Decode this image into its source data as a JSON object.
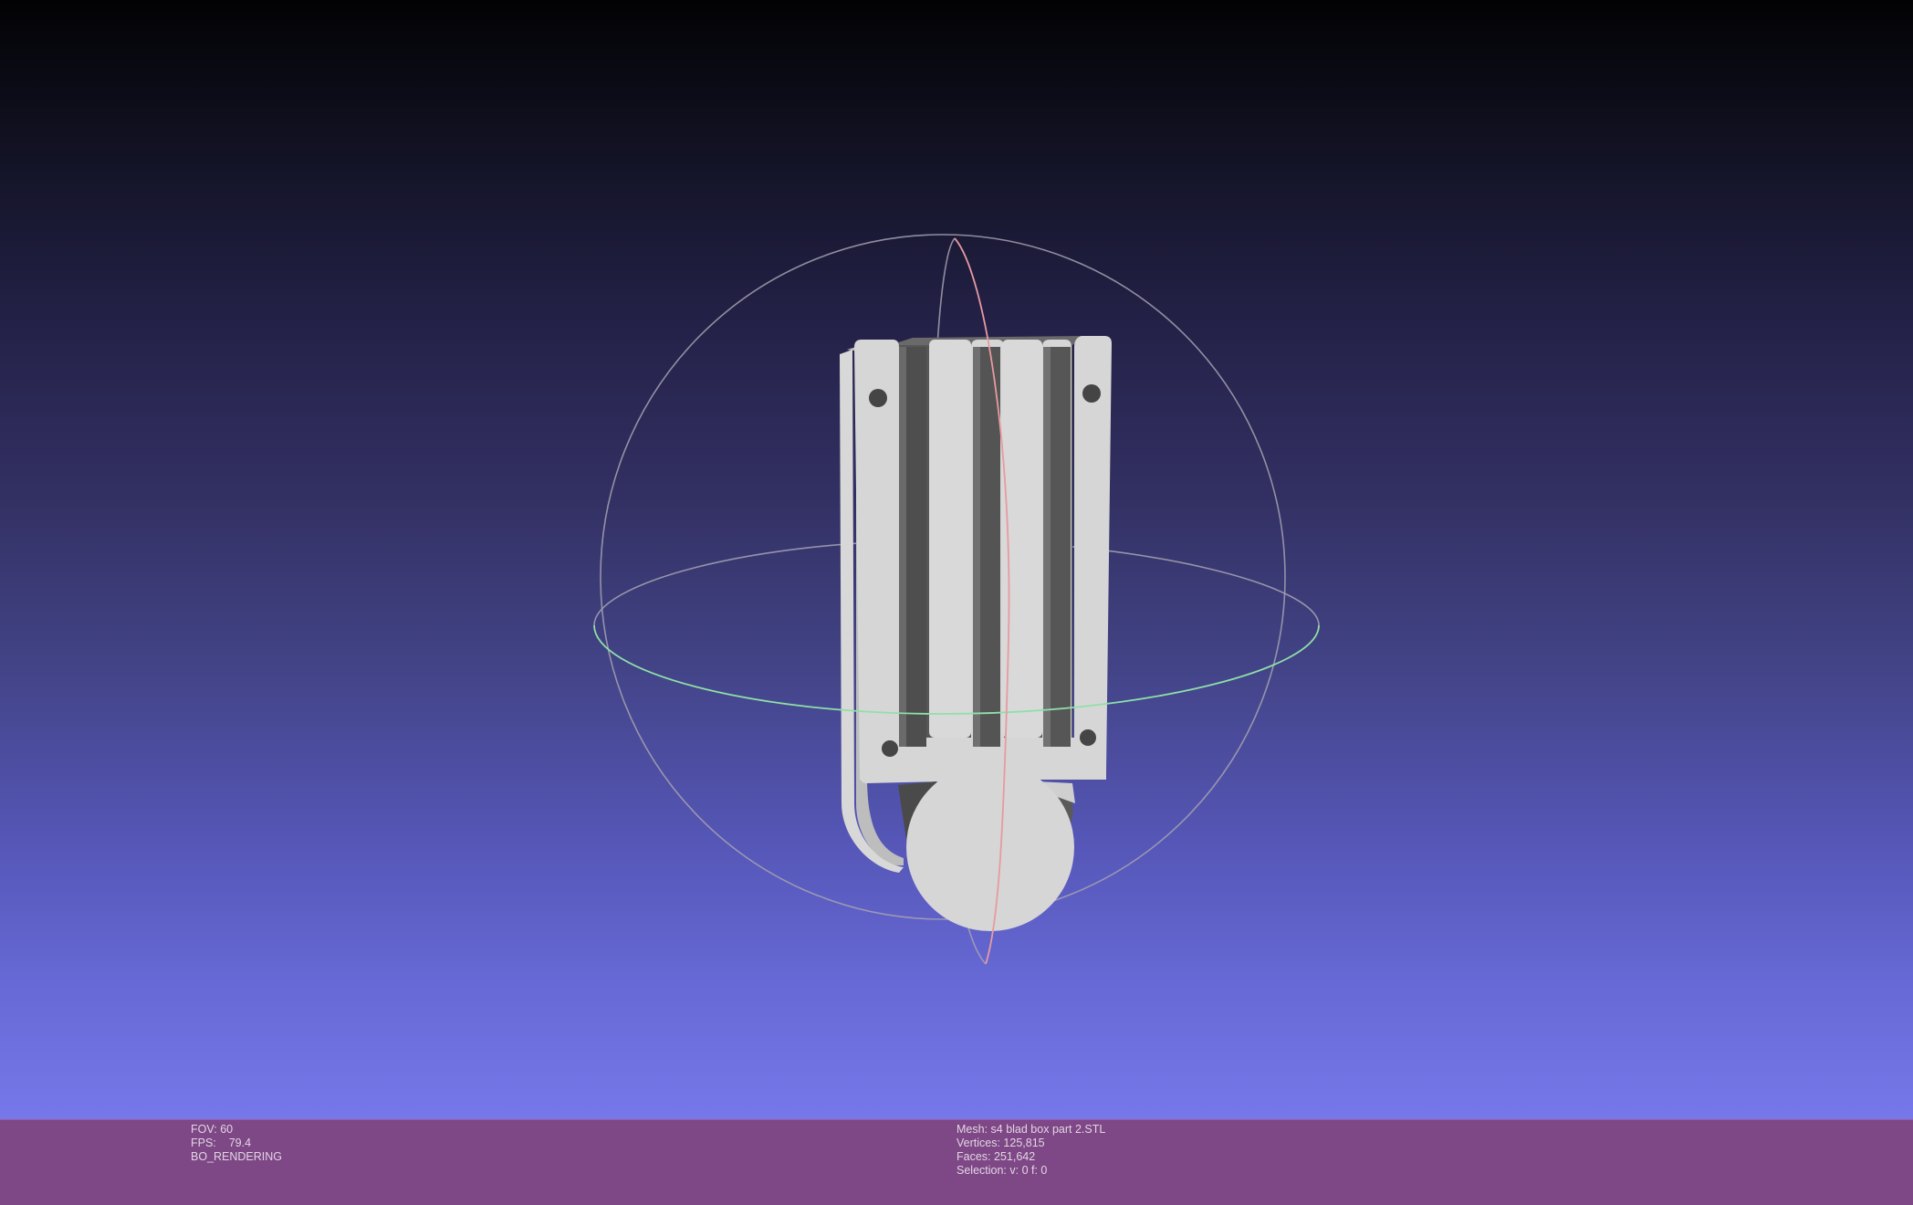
{
  "viewer": {
    "fov_label": "FOV:",
    "fov_value": "60",
    "fps_label": "FPS:",
    "fps_value": "79.4",
    "render_mode": "BO_RENDERING"
  },
  "mesh_info": {
    "mesh_label": "Mesh:",
    "mesh_name": "s4 blad box part 2.STL",
    "vertices_label": "Vertices:",
    "vertices_value": "125,815",
    "faces_label": "Faces:",
    "faces_value": "251,642",
    "selection_label": "Selection:",
    "selection_value": "v: 0 f: 0"
  },
  "colors": {
    "background_top": "#020204",
    "background_bottom": "#7678ea",
    "status_bar": "#7e4786",
    "trackball_horizontal": "#8fe0a8",
    "trackball_vertical": "#e89aa0",
    "trackball_outline": "#a6a2b0",
    "mesh_light": "#d4d4d4",
    "mesh_shadow": "#555555"
  },
  "icons": {
    "trackball": "trackball-gizmo-icon"
  }
}
